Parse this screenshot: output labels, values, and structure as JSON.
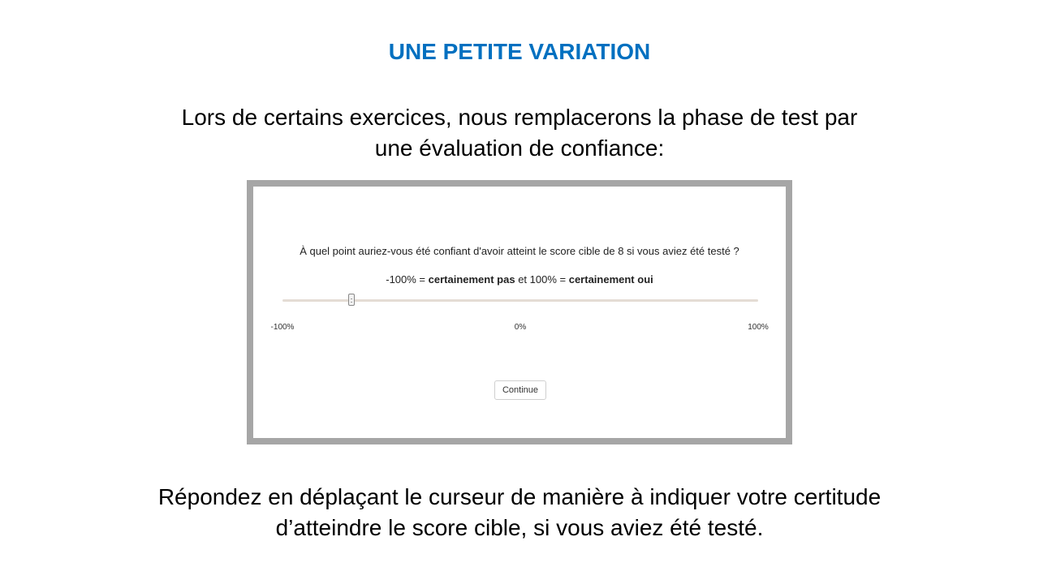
{
  "slide": {
    "title": "UNE PETITE VARIATION",
    "intro_line1": "Lors de certains exercices, nous remplacerons la phase de test par",
    "intro_line2": "une évaluation de confiance:",
    "footer_line1": "Répondez en déplaçant le curseur de manière à indiquer votre certitude",
    "footer_line2": "d’atteindre le score cible, si vous aviez été testé."
  },
  "form": {
    "question": "À quel point auriez-vous été confiant d'avoir atteint le score cible de 8 si vous aviez été testé ?",
    "scale_prefix": "-100% = ",
    "scale_neg_bold": "certainement pas",
    "scale_mid": " et 100% = ",
    "scale_pos_bold": "certainement oui",
    "slider": {
      "min_label": "-100%",
      "mid_label": "0%",
      "max_label": "100%",
      "value": -71
    },
    "continue_label": "Continue"
  },
  "colors": {
    "title": "#0070c0",
    "frame_border": "#a6a6a6",
    "track": "#e4dcd4"
  }
}
